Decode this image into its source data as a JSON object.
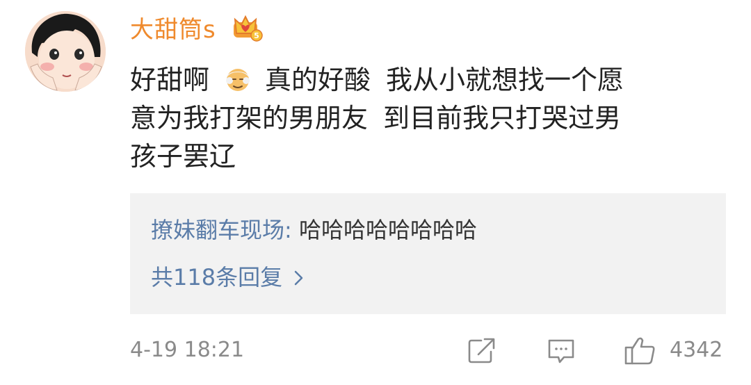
{
  "comment": {
    "username": "大甜筒s",
    "badge_icon": "vip-crown-icon",
    "text_lines": [
      {
        "before_emoji": "好甜啊",
        "emoji": "old-man-face-icon",
        "after_emoji": "真的好酸",
        "rest": "我从小就想找一个愿"
      },
      {
        "part1": "意为我打架的男朋友",
        "part2": "到目前我只打哭过男"
      },
      {
        "part1": "孩子罢辽"
      }
    ]
  },
  "reply": {
    "author": "撩妹翻车现场:",
    "text": "哈哈哈哈哈哈哈哈",
    "more_label": "共118条回复"
  },
  "footer": {
    "timestamp": "4-19 18:21",
    "like_count": "4342"
  },
  "colors": {
    "username": "#ef8a2d",
    "link": "#5a7ca8",
    "reply_bg": "#f2f2f2",
    "meta": "#8a8a8a"
  }
}
